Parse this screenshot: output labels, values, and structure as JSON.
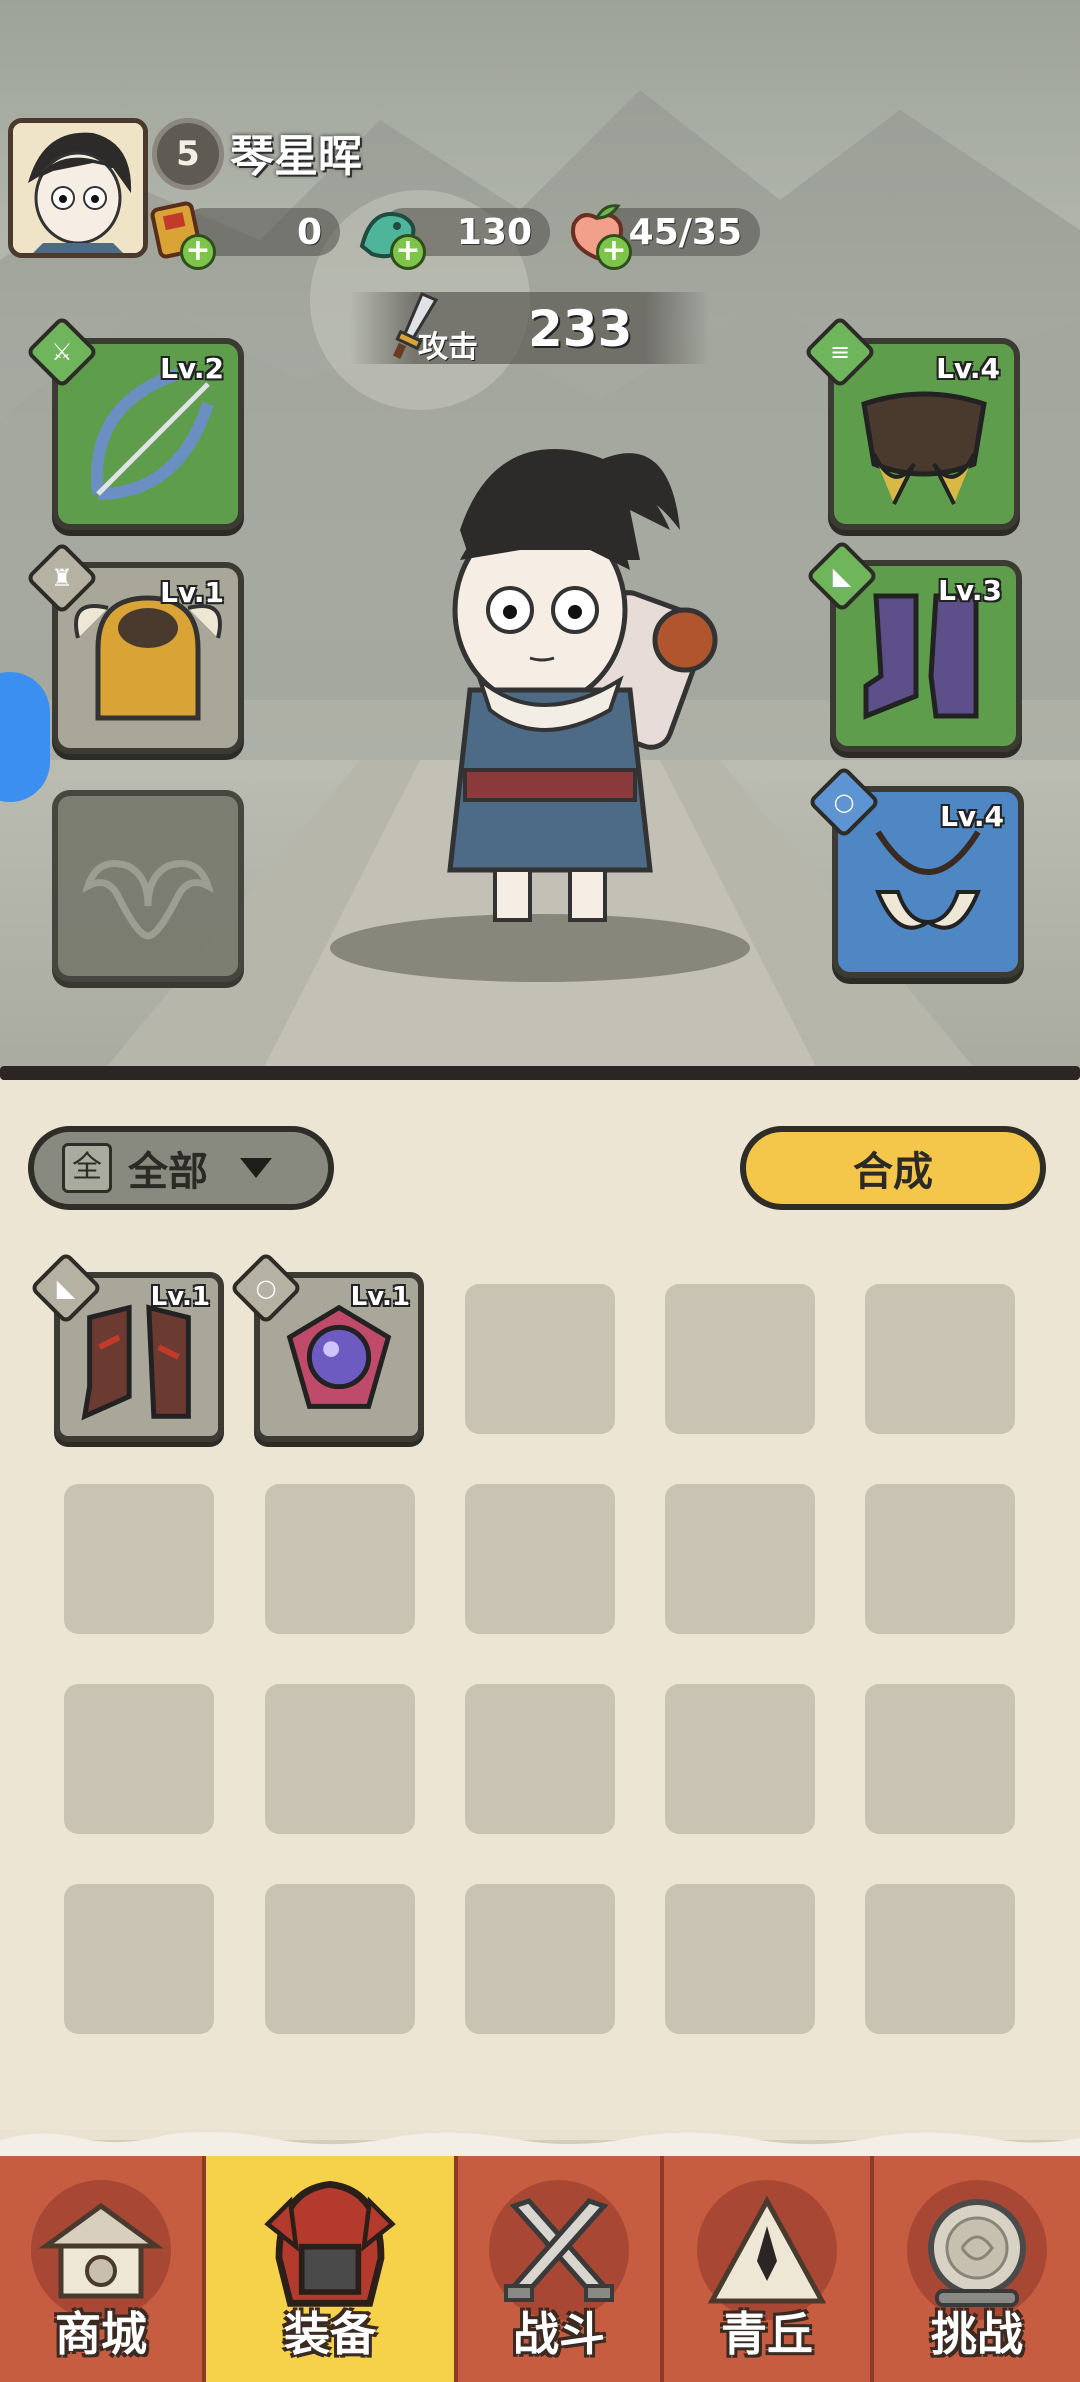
{
  "player": {
    "level": "5",
    "name": "琴星晖"
  },
  "resources": [
    {
      "name": "gold-token",
      "value": "0"
    },
    {
      "name": "jade-dragon",
      "value": "130"
    },
    {
      "name": "peach",
      "value": "45/35"
    }
  ],
  "attack": {
    "label": "攻击",
    "value": "233"
  },
  "equipped": {
    "weapon": {
      "level": "Lv.2",
      "icon": "bow-icon",
      "rarity": "green"
    },
    "helmet": {
      "level": "Lv.1",
      "icon": "helmet-icon",
      "rarity": "grey"
    },
    "amulet": {
      "level": "",
      "icon": "amulet-placeholder-icon",
      "rarity": "empty"
    },
    "belt": {
      "level": "Lv.4",
      "icon": "belt-icon",
      "rarity": "green"
    },
    "boots": {
      "level": "Lv.3",
      "icon": "boots-icon",
      "rarity": "green"
    },
    "necklace": {
      "level": "Lv.4",
      "icon": "fang-necklace-icon",
      "rarity": "blue"
    }
  },
  "inventory": {
    "filter": {
      "icon_char": "全",
      "label": "全部"
    },
    "synthesize_label": "合成",
    "items": [
      {
        "level": "Lv.1",
        "icon": "boots-icon"
      },
      {
        "level": "Lv.1",
        "icon": "orb-accessory-icon"
      }
    ],
    "grid": {
      "columns": 5,
      "rows": 4
    }
  },
  "nav": [
    {
      "label": "商城",
      "icon": "shop-icon",
      "active": false
    },
    {
      "label": "装备",
      "icon": "equipment-icon",
      "active": true
    },
    {
      "label": "战斗",
      "icon": "crossed-swords-icon",
      "active": false
    },
    {
      "label": "青丘",
      "icon": "mountain-icon",
      "active": false
    },
    {
      "label": "挑战",
      "icon": "challenge-orb-icon",
      "active": false
    }
  ],
  "colors": {
    "accent_yellow": "#f6d24b",
    "nav_red": "#c65c40",
    "rarity_green": "#5e9d4c",
    "rarity_blue": "#4f86c4",
    "rarity_grey": "#a8a79a"
  }
}
